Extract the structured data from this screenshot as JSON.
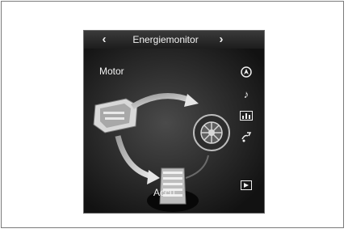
{
  "header": {
    "title": "Energiemonitor",
    "prev_icon": "chevron-left-icon",
    "next_icon": "chevron-right-icon"
  },
  "diagram": {
    "motor_label": "Motor",
    "battery_label": "Accu"
  },
  "side_menu": {
    "items": [
      {
        "icon": "navigation-icon"
      },
      {
        "icon": "music-note-icon"
      },
      {
        "icon": "energy-graph-icon"
      },
      {
        "icon": "climate-fan-icon"
      },
      {
        "icon": "display-icon"
      }
    ]
  },
  "colors": {
    "screen_bg": "#111111",
    "arrow": "#bdbdbd",
    "text": "#f3f3f3"
  }
}
